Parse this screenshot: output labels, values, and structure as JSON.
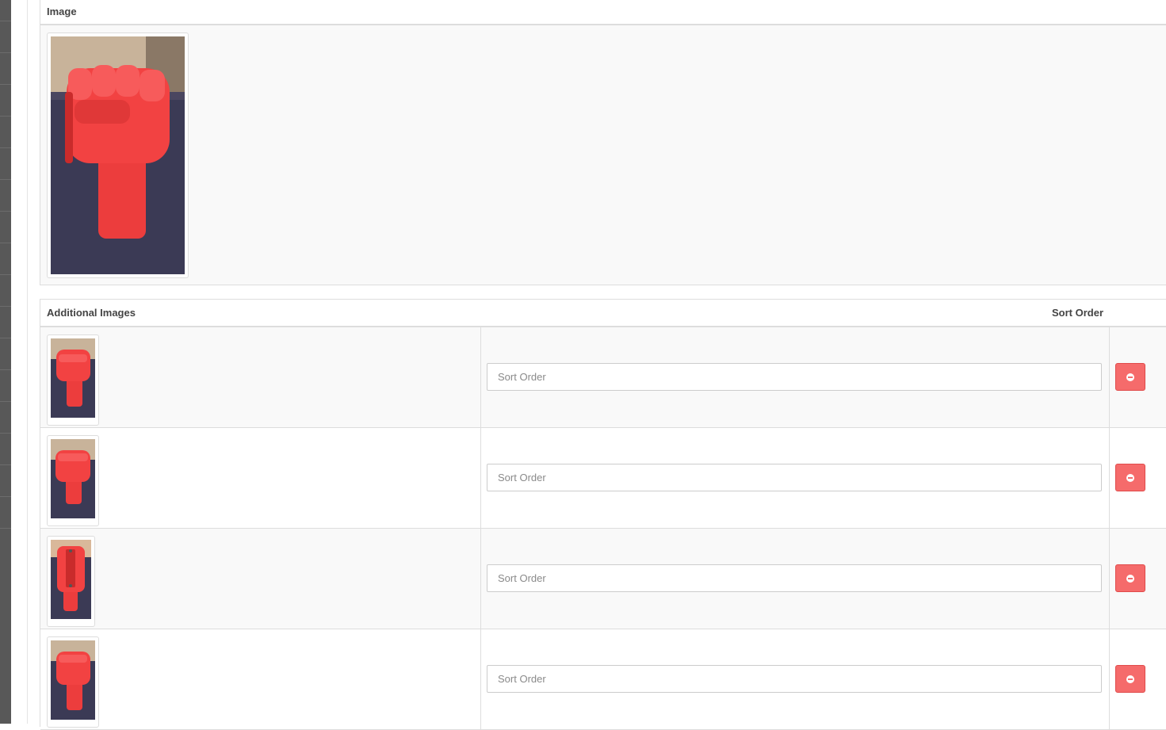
{
  "image_section": {
    "header": "Image",
    "main_image": {
      "alt": "red fist product photo"
    }
  },
  "additional_images": {
    "header_image": "Additional Images",
    "header_sort": "Sort Order",
    "rows": [
      {
        "sort_placeholder": "Sort Order",
        "sort_value": ""
      },
      {
        "sort_placeholder": "Sort Order",
        "sort_value": ""
      },
      {
        "sort_placeholder": "Sort Order",
        "sort_value": ""
      },
      {
        "sort_placeholder": "Sort Order",
        "sort_value": ""
      }
    ]
  },
  "colors": {
    "remove_button": "#f56b6b",
    "border": "#dddddd",
    "stripe": "#f9f9f9"
  },
  "icons": {
    "remove": "minus-circle-icon"
  }
}
